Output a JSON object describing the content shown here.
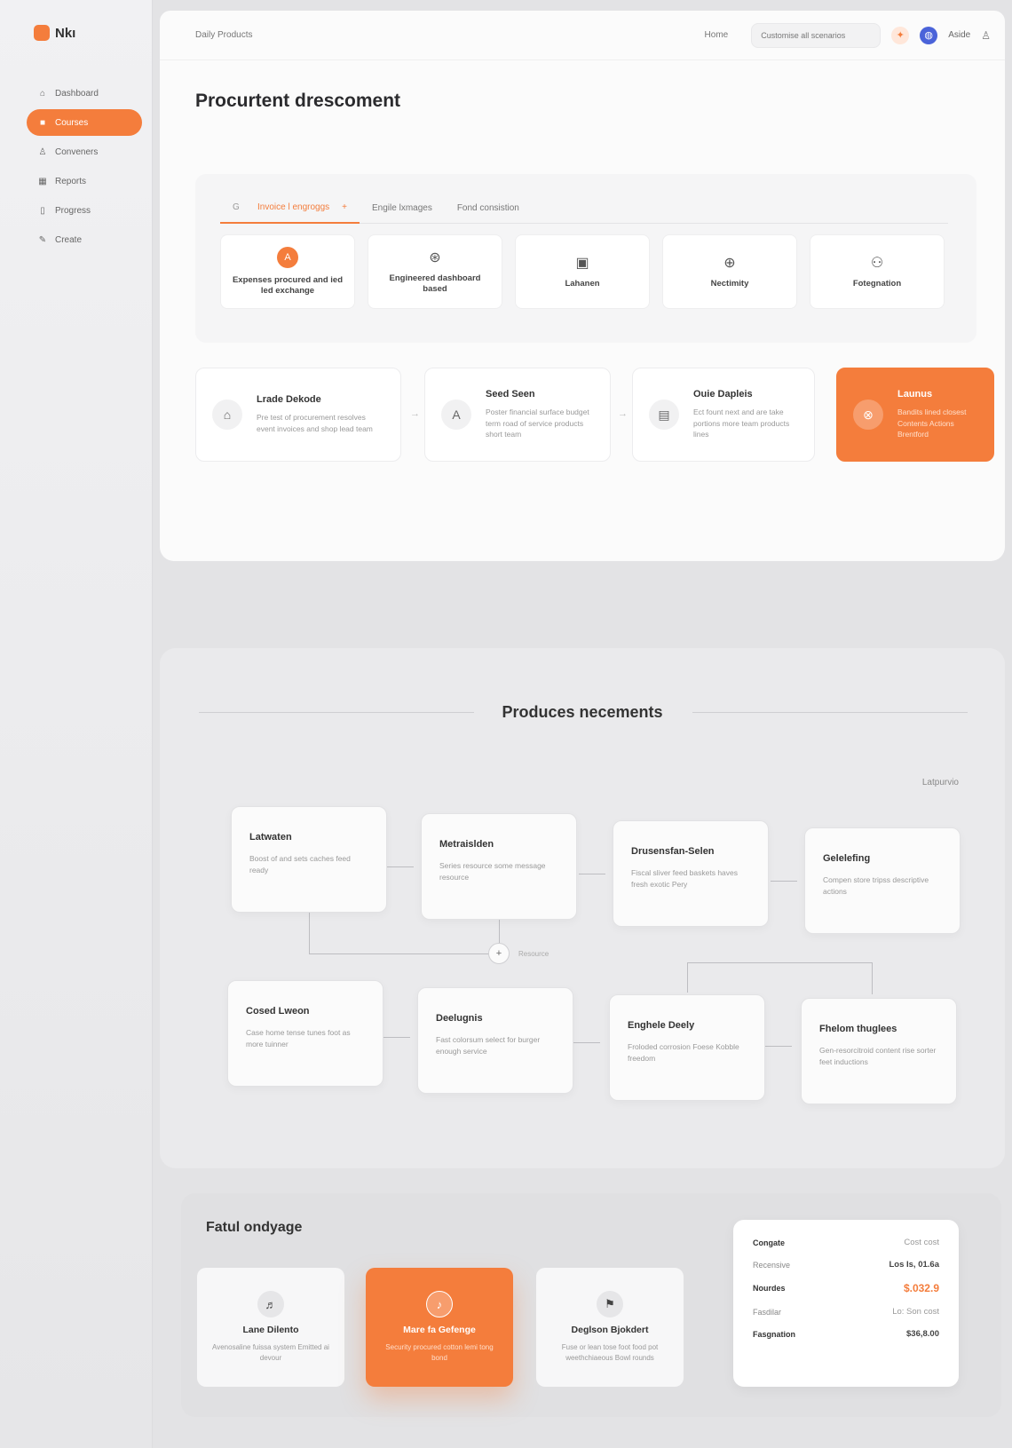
{
  "app": {
    "name": "Nkı",
    "accent": "#f47d3c"
  },
  "sidebar": {
    "items": [
      {
        "label": "Dashboard",
        "icon": "home-icon"
      },
      {
        "label": "Courses",
        "icon": "box-icon",
        "active": true
      },
      {
        "label": "Conveners",
        "icon": "user-icon"
      },
      {
        "label": "Reports",
        "icon": "calendar-icon"
      },
      {
        "label": "Progress",
        "icon": "document-icon"
      },
      {
        "label": "Create",
        "icon": "edit-icon"
      }
    ]
  },
  "topbar": {
    "breadcrumb": "Daily Products",
    "link": "Home",
    "search_value": "Customise all scenarios",
    "user_name": "Aside"
  },
  "main": {
    "title": "Procurtent drescoment",
    "tabs": [
      {
        "label": "Invoice l engroggs",
        "prefix": "G",
        "suffix": "+",
        "active": true
      },
      {
        "label": "Engile lxmages",
        "prefix": "",
        "suffix": ""
      },
      {
        "label": "Fond consistion",
        "prefix": "",
        "suffix": ""
      }
    ],
    "options": [
      {
        "label": "Expenses procured and ied led exchange",
        "icon": "A"
      },
      {
        "label": "Engineered dashboard based",
        "icon": "⊛"
      },
      {
        "label": "Lahanen",
        "icon": "▣"
      },
      {
        "label": "Nectimity",
        "icon": "⊕"
      },
      {
        "label": "Fotegnation",
        "icon": "⚇"
      }
    ],
    "steps": [
      {
        "title": "Lrade Dekode",
        "desc": "Pre test of procurement resolves event invoices and shop lead team",
        "icon": "⌂"
      },
      {
        "title": "Seed Seen",
        "desc": "Poster financial surface budget term road of service products short team",
        "icon": "A"
      },
      {
        "title": "Ouie Dapleis",
        "desc": "Ect fount next and are take portions more team products lines",
        "icon": "▤"
      },
      {
        "title": "Launus",
        "desc": "Bandits lined closest Contents Actions Brentford",
        "icon": "⊗"
      }
    ]
  },
  "process": {
    "title": "Produces necements",
    "meta": "Latpurvio",
    "nodes": [
      {
        "title": "Latwaten",
        "desc": "Boost of and sets caches feed ready"
      },
      {
        "title": "Metraislden",
        "desc": "Series resource some message resource"
      },
      {
        "title": "Drusensfan-Selen",
        "desc": "Fiscal sliver feed baskets haves fresh exotic Pery"
      },
      {
        "title": "Gelelefing",
        "desc": "Compen store tripss descriptive actions"
      },
      {
        "title": "Cosed Lweon",
        "desc": "Case home tense tunes foot as more tuinner"
      },
      {
        "title": "Deelugnis",
        "desc": "Fast colorsum select for burger enough service"
      },
      {
        "title": "Enghele Deely",
        "desc": "Froloded corrosion Foese Kobble freedom"
      },
      {
        "title": "Fhelom thuglees",
        "desc": "Gen-resorcitroid content rise sorter feet inductions"
      }
    ],
    "plus_label": "Resource"
  },
  "bottom": {
    "title": "Fatul ondyage",
    "cards": [
      {
        "title": "Lane Dilento",
        "desc": "Avenosaline fuissa system Emitted ai devour",
        "icon": "♬"
      },
      {
        "title": "Mare fa Gefenge",
        "desc": "Security procured cotton lemi tong bond",
        "icon": "♪",
        "active": true
      },
      {
        "title": "Deglson Bjokdert",
        "desc": "Fuse or lean tose foot food pot weethchiaeous Bowl rounds",
        "icon": "⚑"
      }
    ],
    "summary": {
      "rows": [
        {
          "label": "Congate",
          "value": "Cost cost"
        },
        {
          "label": "Recensive",
          "value": "Los Is, 01.6a"
        },
        {
          "label": "Nourdes",
          "value": "$.032.9"
        },
        {
          "label": "Fasdilar",
          "value": "Lo: Son cost"
        },
        {
          "label": "Fasgnation",
          "value": "$36,8.00"
        }
      ]
    }
  }
}
